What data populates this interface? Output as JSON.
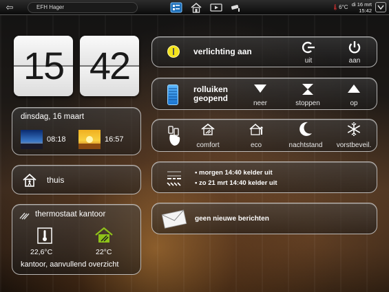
{
  "topbar": {
    "back_icon": "back-arrow-icon",
    "title": "EFH Hager",
    "nav_icons": [
      "dashboard-icon",
      "home-icon",
      "media-icon",
      "camera-icon"
    ],
    "temperature": "6°C",
    "date": "di 16 mrt",
    "time": "15:42",
    "menu_icon": "chevron-down-icon"
  },
  "clock": {
    "hours": "15",
    "minutes": "42"
  },
  "day": {
    "date_label": "dinsdag, 16 maart",
    "sunrise": "08:18",
    "sunset": "16:57"
  },
  "presence": {
    "label": "thuis"
  },
  "thermostat": {
    "title": "thermostaat kantoor",
    "current_temp": "22,6°C",
    "set_temp": "22°C",
    "footer": "kantoor, aanvullend overzicht"
  },
  "lighting": {
    "status": "verlichting aan",
    "off_label": "uit",
    "on_label": "aan"
  },
  "shutters": {
    "status_line1": "rolluiken",
    "status_line2": "geopend",
    "down_label": "neer",
    "stop_label": "stoppen",
    "up_label": "op"
  },
  "scenes": {
    "items": [
      "comfort",
      "eco",
      "nachtstand",
      "vorstbeveil."
    ]
  },
  "timers": {
    "items": [
      "morgen 14:40 kelder uit",
      "zo 21 mrt 14:40 kelder uit"
    ]
  },
  "messages": {
    "label": "geen nieuwe berichten"
  },
  "colors": {
    "accent_blue": "#2a8fe6",
    "indicator_yellow": "#f2e21a",
    "eco_green": "#8fc21a"
  }
}
